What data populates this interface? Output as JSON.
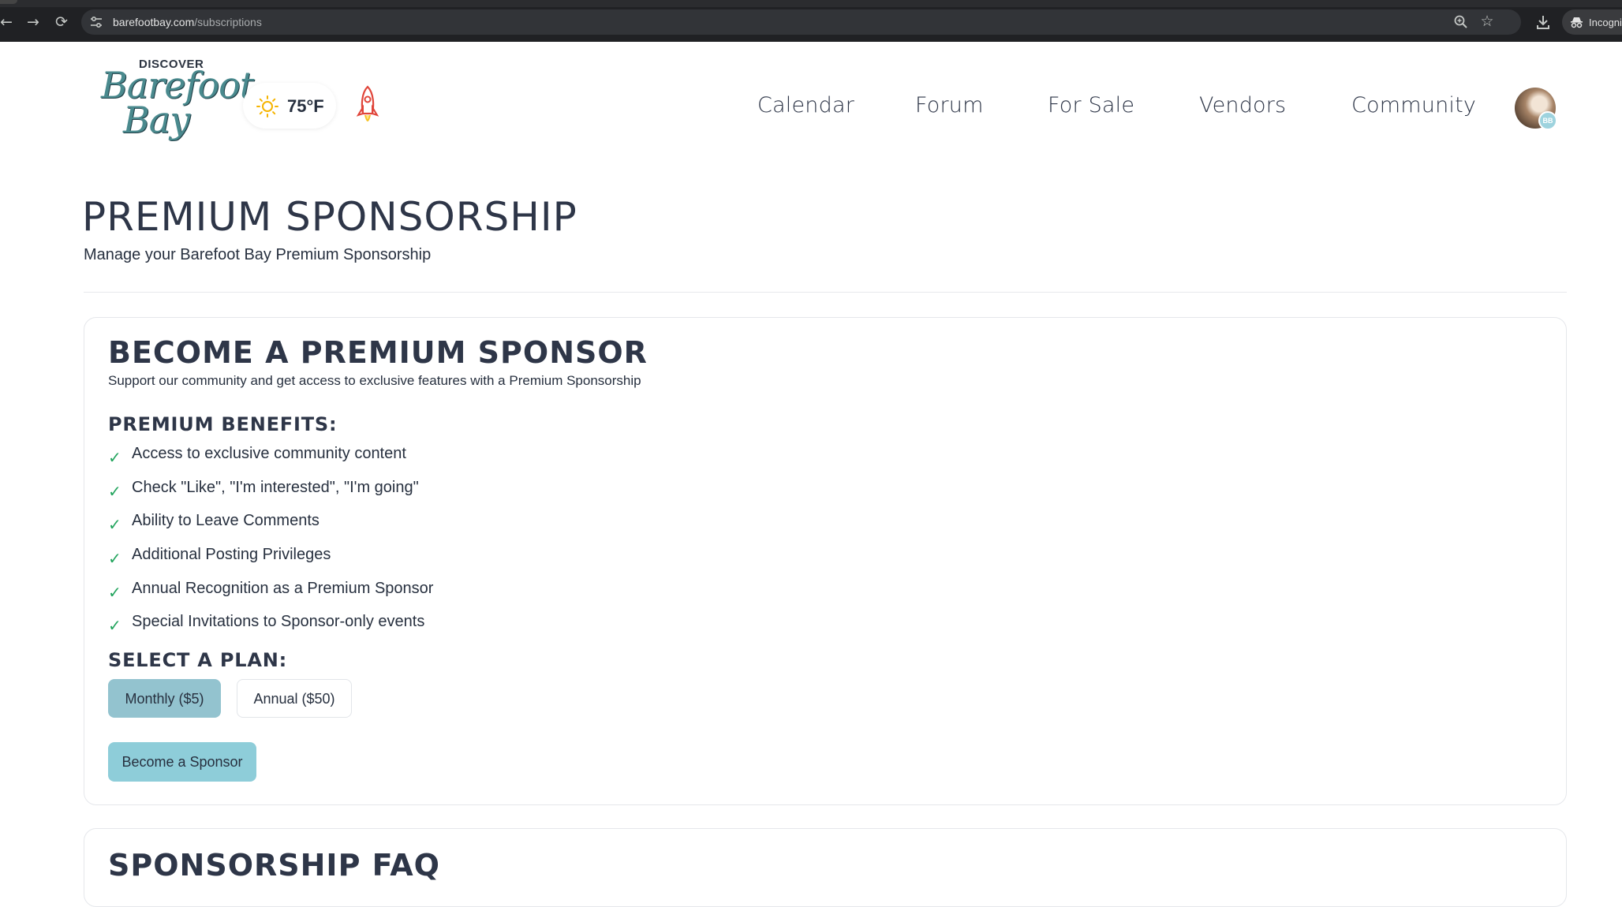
{
  "browser": {
    "url_host": "barefootbay.com",
    "url_path": "/subscriptions",
    "incognito_label": "Incognito"
  },
  "header": {
    "logo": {
      "top": "DISCOVER",
      "line1": "Barefoot",
      "line2": "Bay"
    },
    "weather": {
      "temp": "75°F",
      "icon": "sun-icon"
    },
    "rocket_icon": "rocket-icon",
    "nav": [
      "Calendar",
      "Forum",
      "For Sale",
      "Vendors",
      "Community"
    ],
    "avatar_initials": "BB"
  },
  "page": {
    "title": "PREMIUM SPONSORSHIP",
    "subtitle": "Manage your Barefoot Bay Premium Sponsorship"
  },
  "sponsor_card": {
    "title": "BECOME A PREMIUM SPONSOR",
    "subtitle": "Support our community and get access to exclusive features with a Premium Sponsorship",
    "benefits_label": "PREMIUM BENEFITS:",
    "benefits": [
      "Access to exclusive community content",
      "Check \"Like\", \"I'm interested\", \"I'm going\"",
      "Ability to Leave Comments",
      "Additional Posting Privileges",
      "Annual Recognition as a Premium Sponsor",
      "Special Invitations to Sponsor-only events"
    ],
    "plan_label": "SELECT A PLAN:",
    "plans": [
      {
        "label": "Monthly ($5)",
        "selected": true
      },
      {
        "label": "Annual ($50)",
        "selected": false
      }
    ],
    "cta": "Become a Sponsor"
  },
  "faq_card": {
    "title": "SPONSORSHIP FAQ"
  },
  "colors": {
    "accent": "#93c3cf",
    "cta": "#8ecdd9",
    "check": "#22a45d",
    "heading": "#2e3648"
  }
}
